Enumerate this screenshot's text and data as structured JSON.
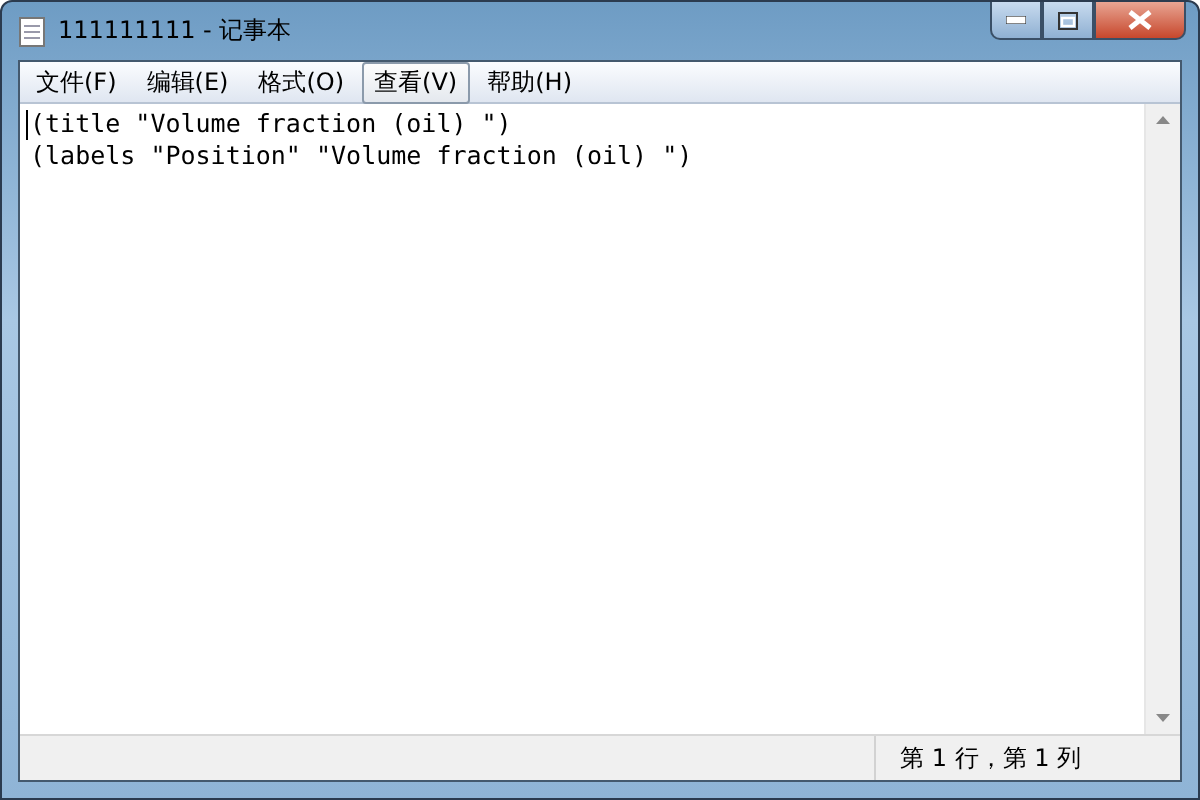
{
  "window": {
    "title": "111111111 - 记事本"
  },
  "menu": [
    {
      "label": "文件(F)",
      "selected": false
    },
    {
      "label": "编辑(E)",
      "selected": false
    },
    {
      "label": "格式(O)",
      "selected": false
    },
    {
      "label": "查看(V)",
      "selected": true
    },
    {
      "label": "帮助(H)",
      "selected": false
    }
  ],
  "editor": {
    "lines": [
      "(title \"Volume fraction (oil) \")",
      "(labels \"Position\" \"Volume fraction (oil) \")"
    ]
  },
  "status_bar": {
    "position": "第 1 行，第 1 列"
  }
}
